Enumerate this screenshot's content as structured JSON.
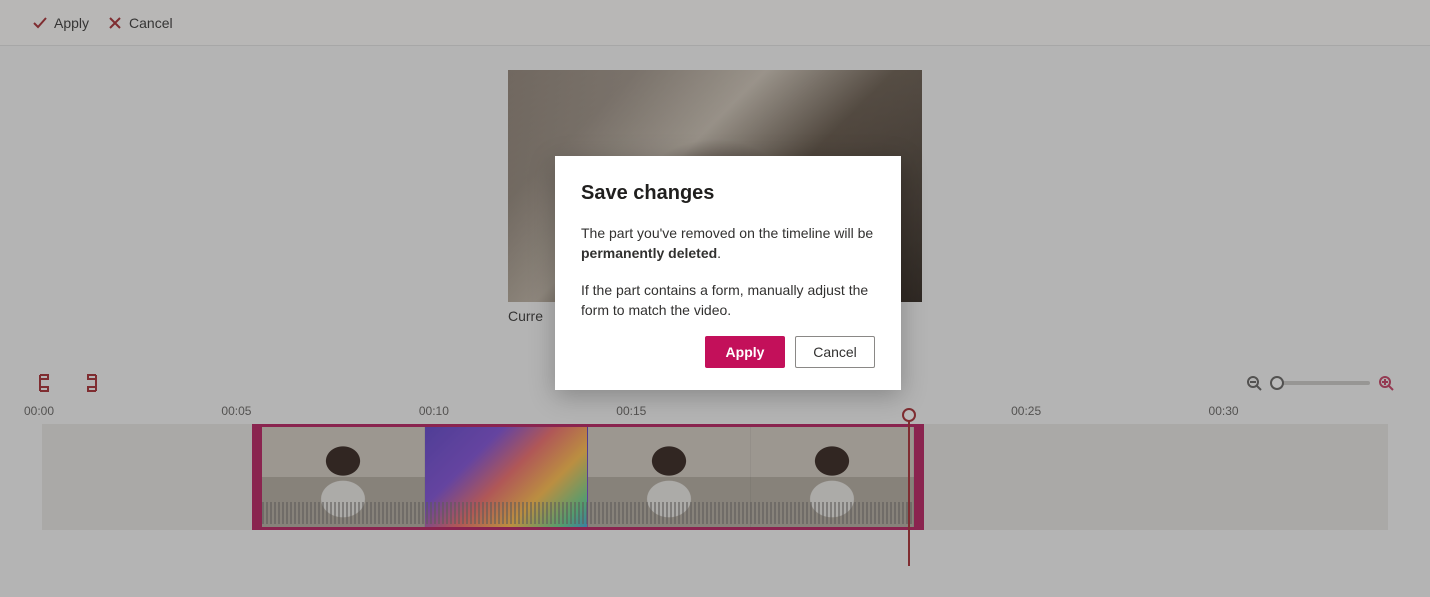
{
  "toolbar": {
    "apply_label": "Apply",
    "cancel_label": "Cancel"
  },
  "preview": {
    "label_prefix": "Curre"
  },
  "dialog": {
    "title": "Save changes",
    "body_part1": "The part you've removed on the timeline will be ",
    "body_bold": "permanently deleted",
    "body_part1_end": ".",
    "body_part2": "If the part contains a form, manually adjust the form to match the video.",
    "apply_label": "Apply",
    "cancel_label": "Cancel"
  },
  "timeline": {
    "timestamps": [
      "00:00",
      "00:05",
      "00:10",
      "00:15",
      "",
      "00:25",
      "00:30"
    ]
  },
  "colors": {
    "accent": "#c3105a",
    "accent_dark": "#a4262c"
  }
}
